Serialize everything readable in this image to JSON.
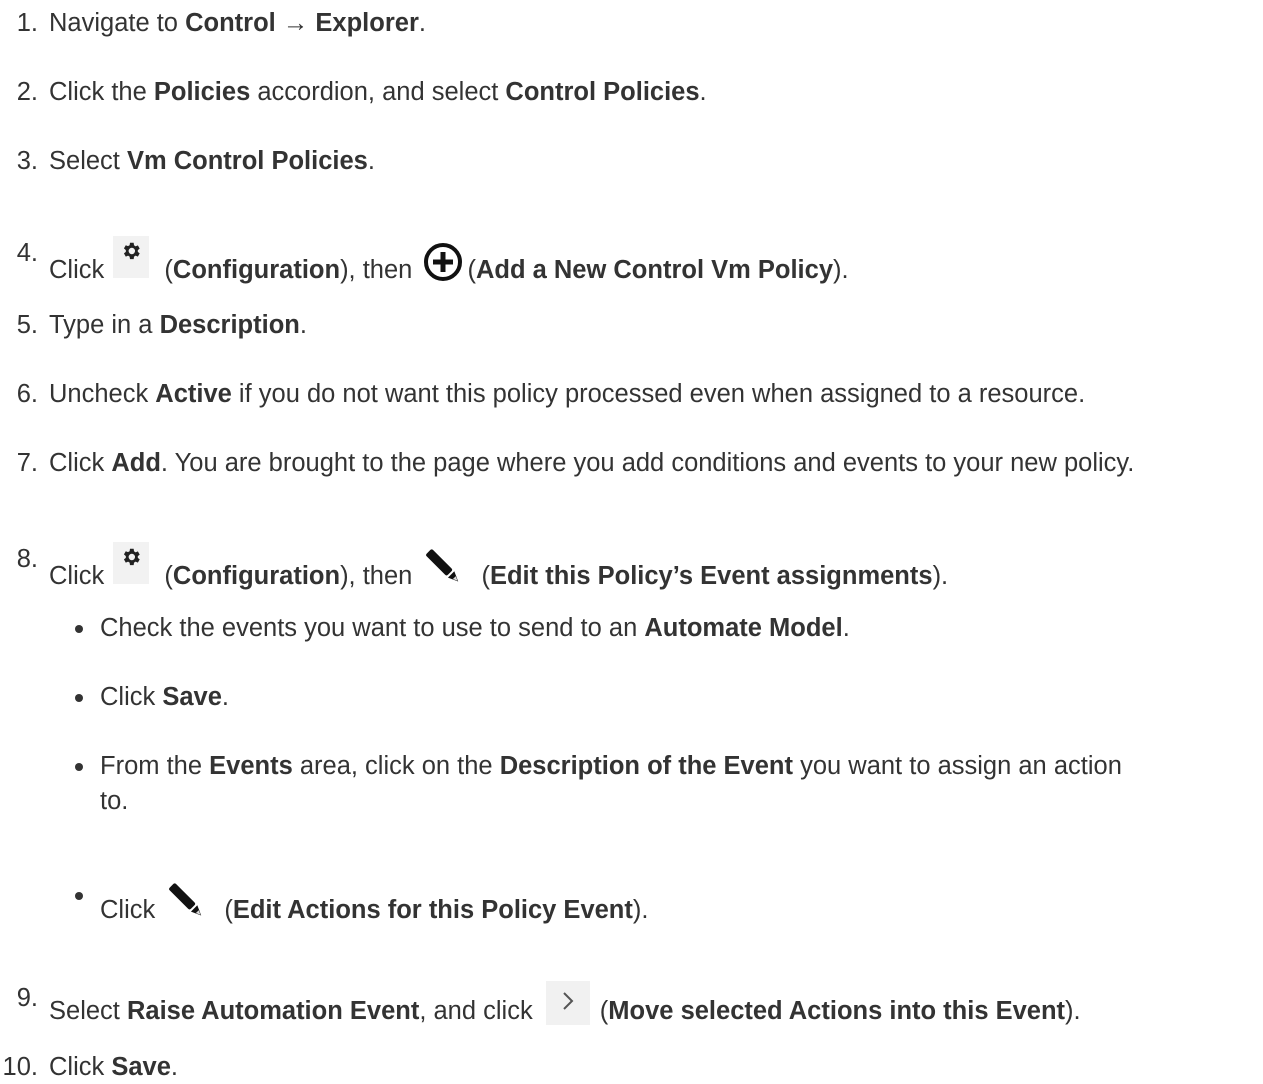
{
  "steps": {
    "s1": {
      "num": "1.",
      "t1": "Navigate to ",
      "b1": "Control → Explorer",
      "t2": "."
    },
    "s2": {
      "num": "2.",
      "t1": "Click the ",
      "b1": "Policies",
      "t2": " accordion, and select ",
      "b2": "Control Policies",
      "t3": "."
    },
    "s3": {
      "num": "3.",
      "t1": "Select ",
      "b1": "Vm Control Policies",
      "t2": "."
    },
    "s4": {
      "num": "4.",
      "t1": "Click ",
      "t2": " (",
      "b1": "Configuration",
      "t3": "), then ",
      "t4": "(",
      "b2": "Add a New Control Vm Policy",
      "t5": ")."
    },
    "s5": {
      "num": "5.",
      "t1": "Type in a ",
      "b1": "Description",
      "t2": "."
    },
    "s6": {
      "num": "6.",
      "t1": "Uncheck ",
      "b1": "Active",
      "t2": " if you do not want this policy processed even when assigned to a resource."
    },
    "s7": {
      "num": "7.",
      "t1": "Click ",
      "b1": "Add",
      "t2": ". You are brought to the page where you add conditions and events to your new policy."
    },
    "s8": {
      "num": "8.",
      "t1": "Click ",
      "t2": " (",
      "b1": "Configuration",
      "t3": "), then ",
      "t4": "(",
      "b2": "Edit this Policy’s Event assignments",
      "t5": ")."
    },
    "s8a": {
      "t1": "Check the events you want to use to send to an ",
      "b1": "Automate Model",
      "t2": "."
    },
    "s8b": {
      "t1": "Click ",
      "b1": "Save",
      "t2": "."
    },
    "s8c": {
      "t1": "From the ",
      "b1": "Events",
      "t2": " area, click on the ",
      "b2": "Description of the Event",
      "t3": " you want to assign an action",
      "t4": "to."
    },
    "s8d": {
      "t1": "Click ",
      "t2": "(",
      "b1": "Edit Actions for this Policy Event",
      "t3": ")."
    },
    "s9": {
      "num": "9.",
      "t1": "Select ",
      "b1": "Raise Automation Event",
      "t2": ", and click ",
      "t3": "(",
      "b2": "Move selected Actions into this Event",
      "t4": ")."
    },
    "s10": {
      "num": "10.",
      "t1": "Click ",
      "b1": "Save",
      "t2": "."
    }
  },
  "icons": {
    "configuration": "gear-icon",
    "add": "plus-circle-icon",
    "edit": "pencil-icon",
    "move": "chevron-right-icon"
  },
  "colors": {
    "text": "#333333",
    "icon_bg": "#f2f2f2",
    "icon_fg": "#222222"
  }
}
